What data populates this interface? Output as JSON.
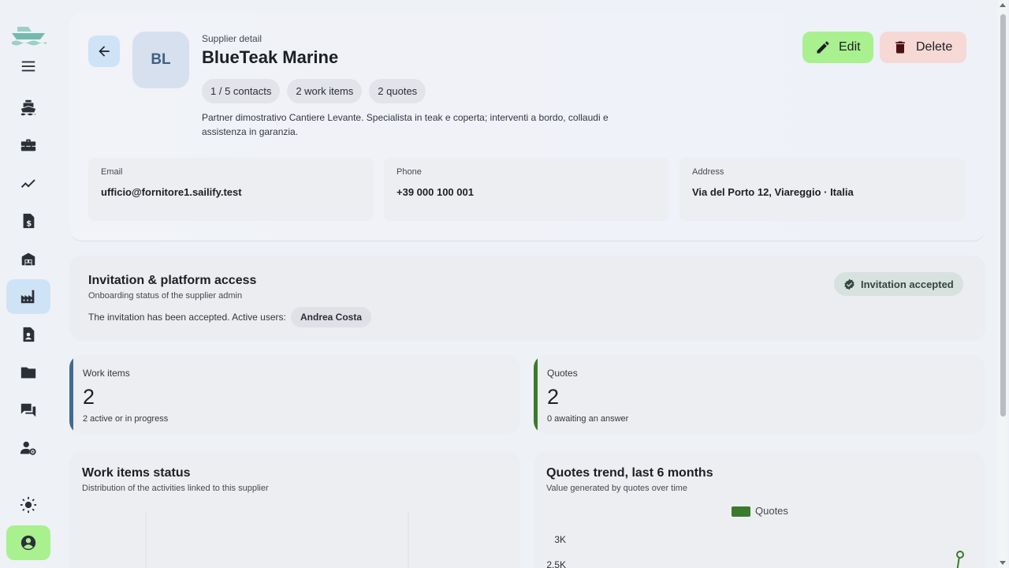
{
  "sidebar": {
    "icons": [
      "ship-logo",
      "menu-icon",
      "ship-icon",
      "toolbox-icon",
      "trend-icon",
      "invoice-icon",
      "warehouse-icon",
      "factory-icon",
      "contact-file-icon",
      "folder-icon",
      "chat-icon",
      "user-settings-icon",
      "theme-icon",
      "account-icon"
    ],
    "active": "factory-icon"
  },
  "header": {
    "subtitle": "Supplier detail",
    "title": "BlueTeak Marine",
    "avatar": "BL",
    "chips": [
      "1 / 5 contacts",
      "2 work items",
      "2 quotes"
    ],
    "description": "Partner dimostrativo Cantiere Levante. Specialista in teak e coperta; interventi a bordo, collaudi e assistenza in garanzia.",
    "edit_label": "Edit",
    "delete_label": "Delete"
  },
  "contact": {
    "email_label": "Email",
    "email": "ufficio@fornitore1.sailify.test",
    "phone_label": "Phone",
    "phone": "+39 000 100 001",
    "address_label": "Address",
    "address": "Via del Porto 12, Viareggio · Italia"
  },
  "invitation": {
    "title": "Invitation & platform access",
    "subtitle": "Onboarding status of the supplier admin",
    "text": "The invitation has been accepted. Active users:",
    "user": "Andrea Costa",
    "badge": "Invitation accepted"
  },
  "stats": {
    "work_items": {
      "label": "Work items",
      "value": "2",
      "sub": "2 active or in progress",
      "color": "#3f6a94"
    },
    "quotes": {
      "label": "Quotes",
      "value": "2",
      "sub": "0 awaiting an answer",
      "color": "#3a7a2c"
    }
  },
  "charts": {
    "status": {
      "title": "Work items status",
      "subtitle": "Distribution of the activities linked to this supplier"
    },
    "trend": {
      "title": "Quotes trend, last 6 months",
      "subtitle": "Value generated by quotes over time"
    }
  },
  "chart_data": {
    "type": "line",
    "title": "Quotes trend, last 6 months",
    "series": [
      {
        "name": "Quotes",
        "values": []
      }
    ],
    "y_ticks": [
      "3K",
      "2.5K"
    ],
    "legend": "top-center",
    "color": "#3a7a2c"
  }
}
